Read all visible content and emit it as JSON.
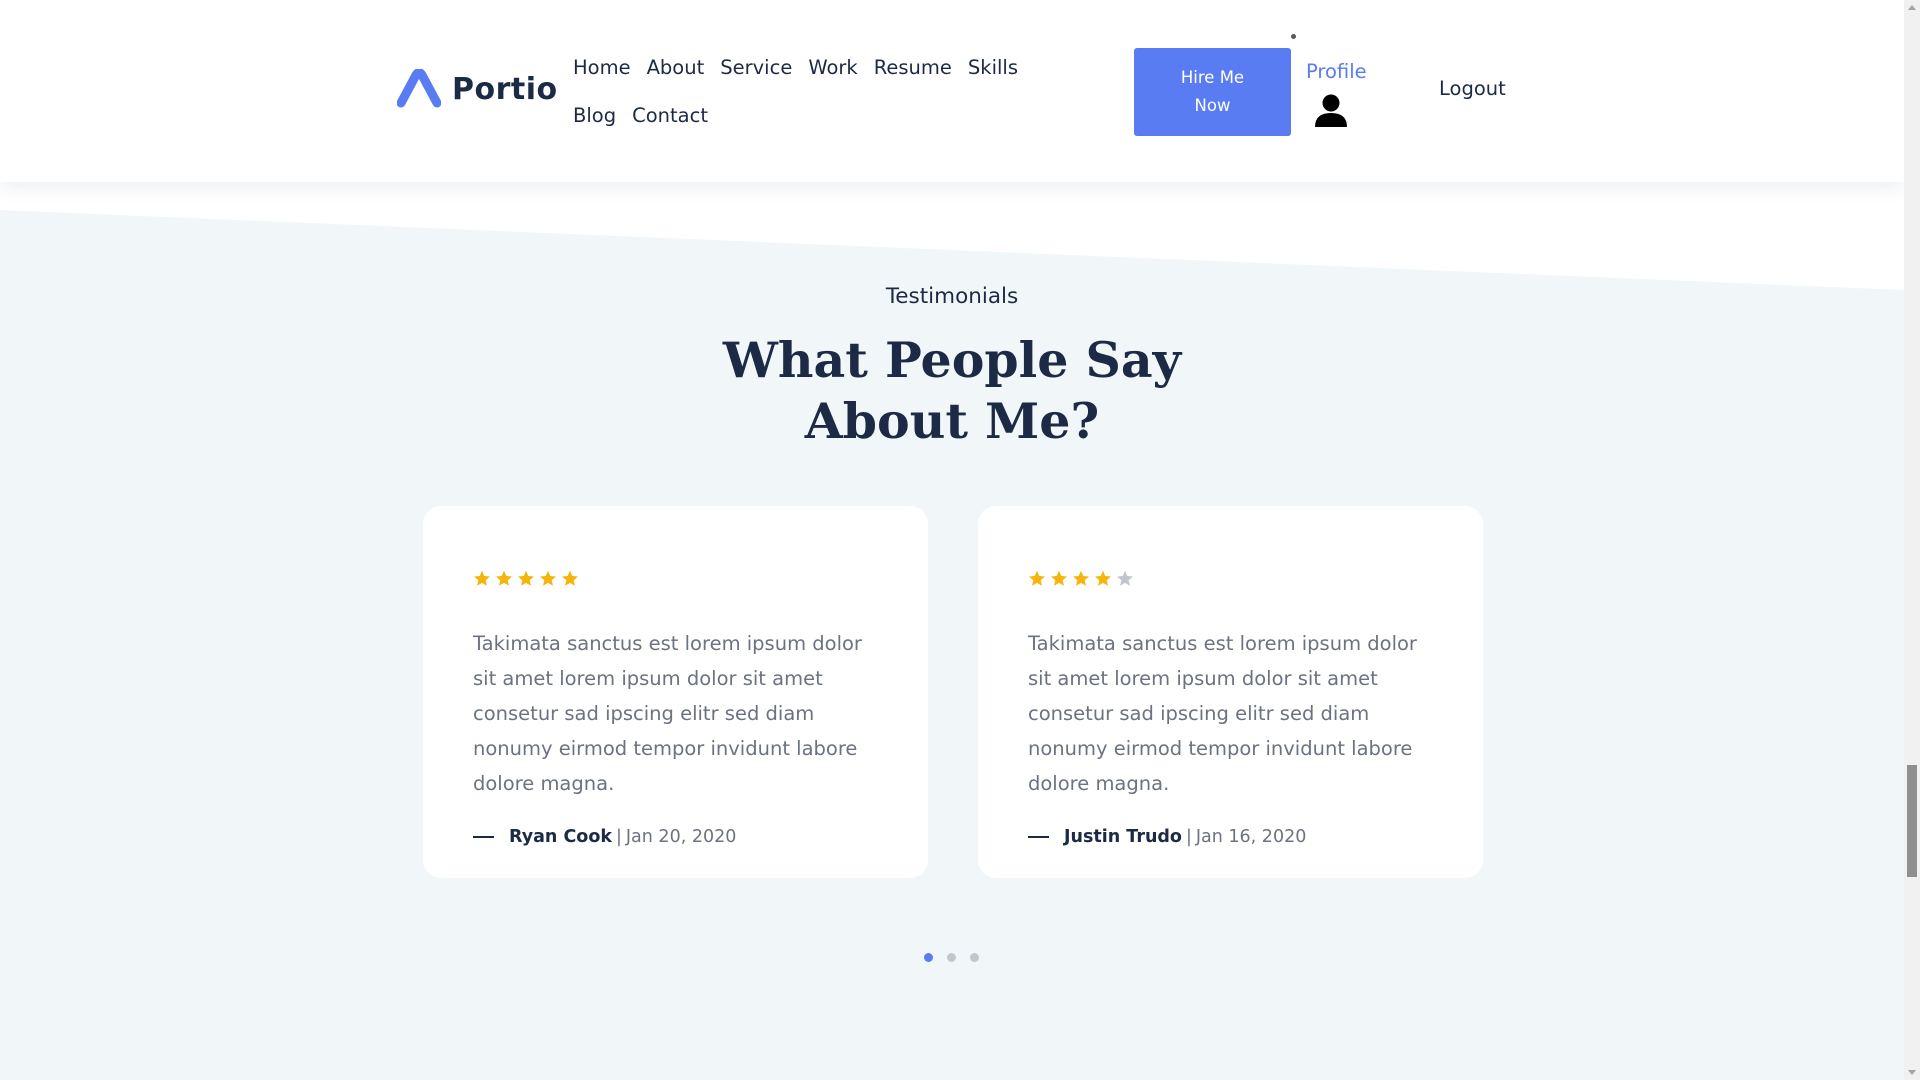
{
  "brand": {
    "name": "Portio",
    "accent": "#5a7cf2",
    "text": "#1c2a45"
  },
  "nav": {
    "items": [
      "Home",
      "About",
      "Service",
      "Work",
      "Resume",
      "Skills",
      "Blog",
      "Contact"
    ],
    "hire_label": "Hire Me Now",
    "profile_label": "Profile",
    "profile_icon": "user-icon",
    "logout_label": "Logout"
  },
  "testimonials": {
    "eyebrow": "Testimonials",
    "heading_line1": "What People Say",
    "heading_line2": "About Me?",
    "cards": [
      {
        "rating": 5,
        "max_rating": 5,
        "quote": "Takimata sanctus est lorem ipsum dolor sit amet lorem ipsum dolor sit amet consetur sad ipscing elitr sed diam nonumy eirmod tempor invidunt labore dolore magna.",
        "author": "Ryan Cook",
        "separator": "|",
        "date": "Jan 20, 2020"
      },
      {
        "rating": 4,
        "max_rating": 5,
        "quote": "Takimata sanctus est lorem ipsum dolor sit amet lorem ipsum dolor sit amet consetur sad ipscing elitr sed diam nonumy eirmod tempor invidunt labore dolore magna.",
        "author": "Justin Trudo",
        "separator": "|",
        "date": "Jan 16, 2020"
      }
    ],
    "pagination": {
      "count": 3,
      "active": 0
    },
    "colors": {
      "section_bg": "#f1f7f9",
      "star_filled": "#f5b50a",
      "star_empty": "#c2c6cc"
    }
  }
}
